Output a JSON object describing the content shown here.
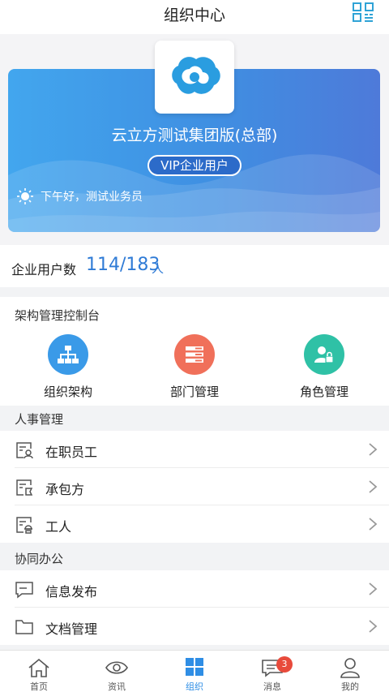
{
  "header": {
    "title": "组织中心",
    "qr_icon": "qrcode-icon"
  },
  "banner": {
    "org_name": "云立方测试集团版(总部)",
    "vip_label": "VIP企业用户",
    "greeting": "下午好，测试业务员",
    "logo_icon": "cloud-logo-icon"
  },
  "users": {
    "label": "企业用户数",
    "count": "114/183",
    "unit": "人"
  },
  "console": {
    "title": "架构管理控制台",
    "tiles": [
      {
        "label": "组织架构",
        "icon": "org-chart-icon",
        "color": "#3a9ae8"
      },
      {
        "label": "部门管理",
        "icon": "department-icon",
        "color": "#f0705a"
      },
      {
        "label": "角色管理",
        "icon": "role-icon",
        "color": "#2fc1a6"
      }
    ]
  },
  "hr": {
    "title": "人事管理",
    "items": [
      {
        "label": "在职员工",
        "icon": "employee-card-icon"
      },
      {
        "label": "承包方",
        "icon": "contractor-icon"
      },
      {
        "label": "工人",
        "icon": "worker-icon"
      }
    ]
  },
  "collab": {
    "title": "协同办公",
    "items": [
      {
        "label": "信息发布",
        "icon": "message-icon"
      },
      {
        "label": "文档管理",
        "icon": "folder-icon"
      }
    ]
  },
  "tabbar": {
    "tabs": [
      {
        "label": "首页",
        "icon": "home-icon"
      },
      {
        "label": "资讯",
        "icon": "eye-icon"
      },
      {
        "label": "组织",
        "icon": "grid-icon",
        "active": true
      },
      {
        "label": "消息",
        "icon": "chat-icon",
        "badge": "3"
      },
      {
        "label": "我的",
        "icon": "user-icon"
      }
    ]
  },
  "colors": {
    "accent": "#2f8ee5",
    "badge": "#e84a3b",
    "banner_start": "#42a6ee",
    "banner_end": "#4e7ad9"
  }
}
